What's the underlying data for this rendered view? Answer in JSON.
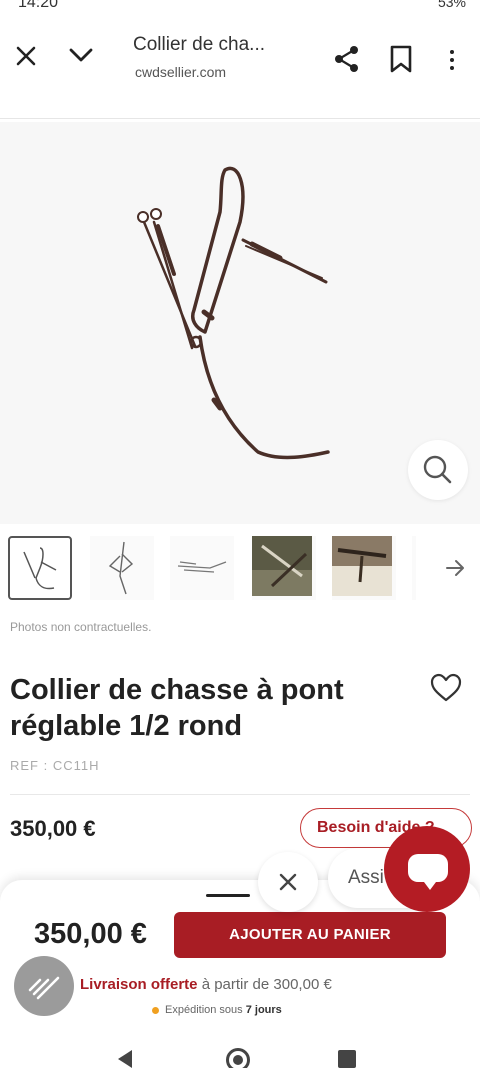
{
  "status_bar": {
    "time": "14:20",
    "battery": "53%"
  },
  "browser": {
    "tab_title": "Collier de cha...",
    "url": "cwdsellier.com"
  },
  "product": {
    "photos_note": "Photos non contractuelles.",
    "title": "Collier de chasse à pont réglable 1/2 rond",
    "ref": "REF : CC11H",
    "price": "350,00 €",
    "help_label": "Besoin d'aide ?",
    "thumbnail_count": 5
  },
  "chat": {
    "assist_label": "Assi"
  },
  "sticky": {
    "price": "350,00 €",
    "cart_label": "AJOUTER AU PANIER",
    "delivery_strong": "Livraison offerte",
    "delivery_rest": " à partir de 300,00 €",
    "expedition_prefix": "Expédition sous ",
    "expedition_strong": "7 jours"
  },
  "colors": {
    "brand_red": "#a81d24",
    "text_dark": "#222222",
    "muted": "#999999"
  },
  "icons": [
    "close-icon",
    "chevron-down-icon",
    "share-icon",
    "bookmark-icon",
    "more-vert-icon",
    "zoom-icon",
    "arrow-right-icon",
    "heart-icon",
    "chat-icon",
    "shipping-icon"
  ]
}
